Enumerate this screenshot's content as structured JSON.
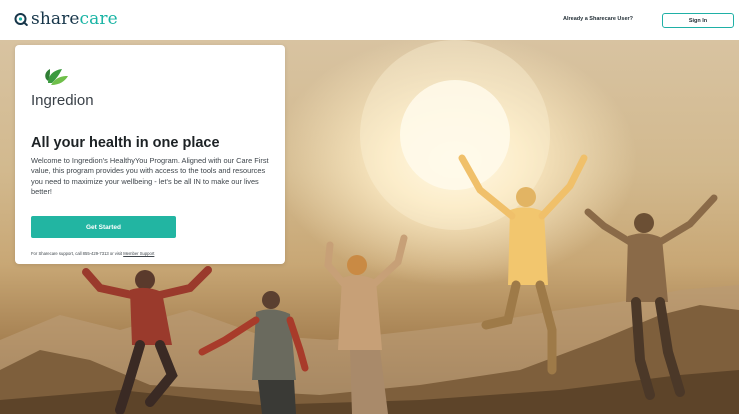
{
  "header": {
    "logo_text_share": "share",
    "logo_text_care": "care",
    "already_user": "Already a Sharecare User?",
    "sign_in_label": "Sign In"
  },
  "card": {
    "brand_name": "Ingredion",
    "title": "All your health in one place",
    "body": "Welcome to Ingredion's HealthyYou Program. Aligned with our Care First value, this program provides you with access to the tools and resources you need to maximize your wellbeing - let's be all IN to make our lives better!",
    "cta_label": "Get Started",
    "support_prefix": "For Sharecare support, call 855-429-7313 or visit ",
    "support_link": "Member Support"
  },
  "colors": {
    "accent": "#22b5a2",
    "brand_navy": "#17364a",
    "ingredion_green": "#3b9a3f"
  },
  "icons": {
    "logo": "sharecare-logo-icon",
    "brand": "ingredion-leaf-icon"
  }
}
